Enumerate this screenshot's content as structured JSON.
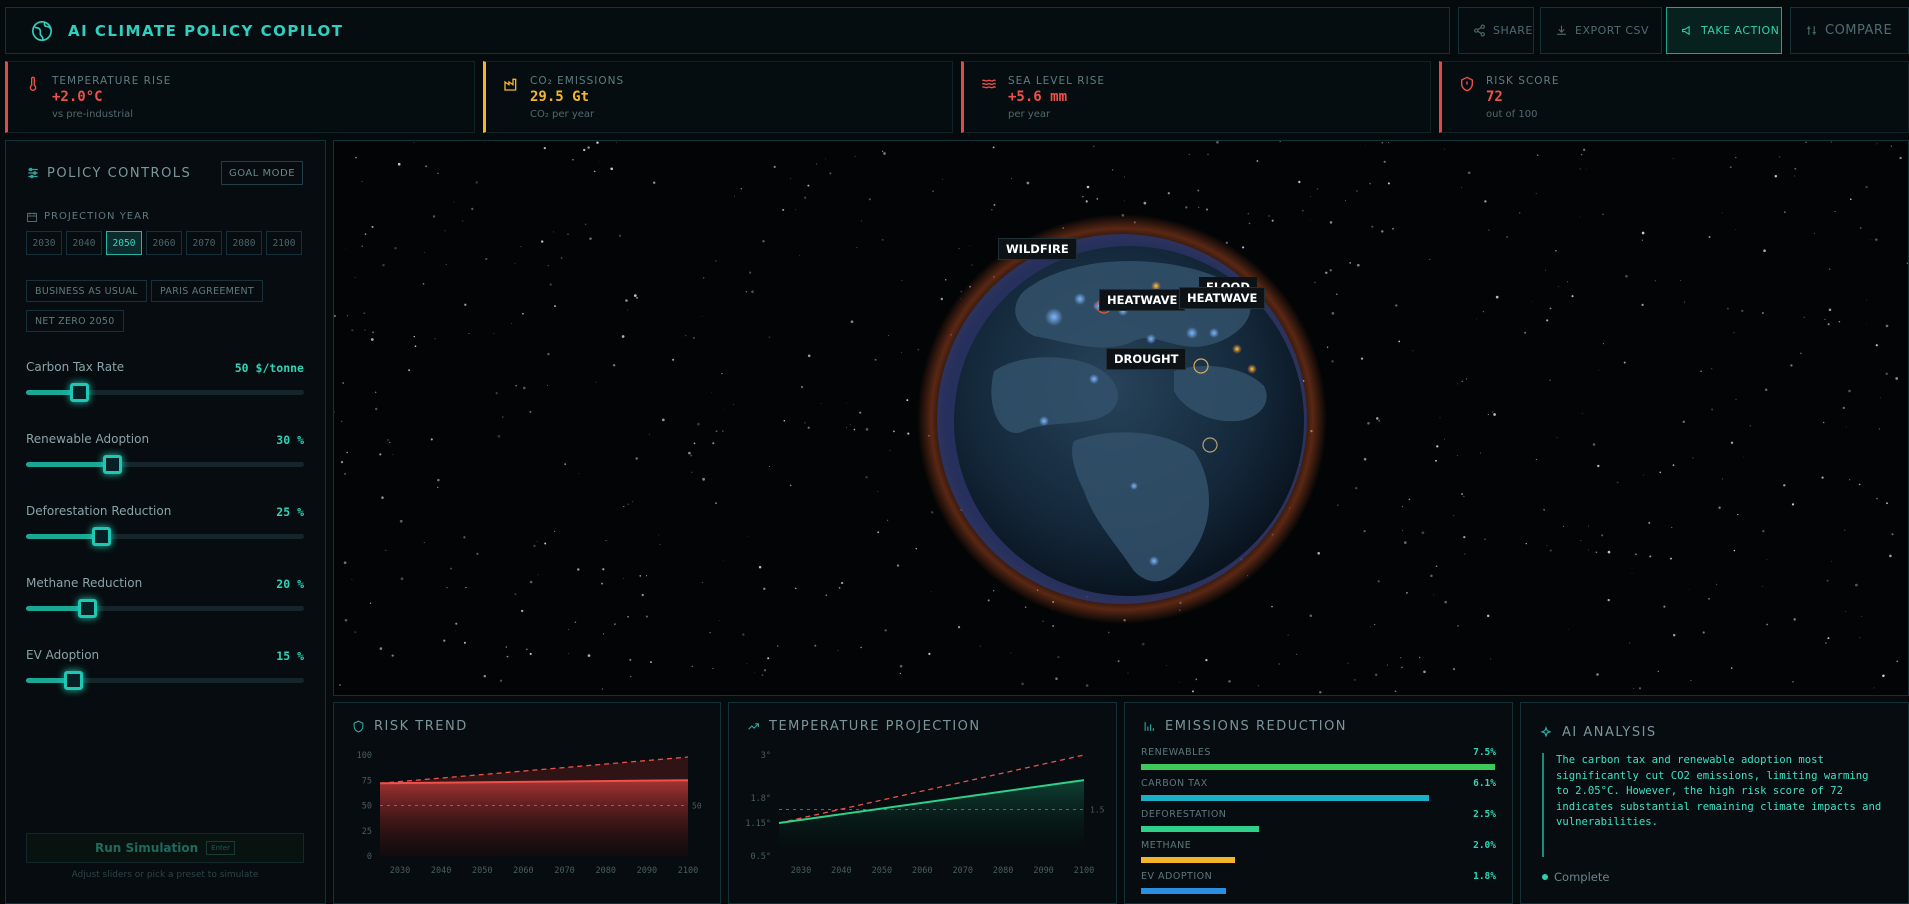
{
  "header": {
    "title": "AI CLIMATE POLICY COPILOT",
    "buttons": {
      "share": "SHARE",
      "export": "EXPORT CSV",
      "action": "TAKE ACTION",
      "compare": "COMPARE"
    }
  },
  "kpis": [
    {
      "label": "TEMPERATURE RISE",
      "value": "+2.0°C",
      "sub": "vs pre-industrial",
      "color": "#f0504a"
    },
    {
      "label": "CO₂ EMISSIONS",
      "value": "29.5 Gt",
      "sub": "CO₂ per year",
      "color": "#f5b52a"
    },
    {
      "label": "SEA LEVEL RISE",
      "value": "+5.6 mm",
      "sub": "per year",
      "color": "#f0504a"
    },
    {
      "label": "RISK SCORE",
      "value": "72",
      "sub": "out of 100",
      "color": "#f0504a"
    }
  ],
  "policy": {
    "title": "POLICY CONTROLS",
    "goal_mode": "GOAL MODE",
    "year_label": "PROJECTION YEAR",
    "years": [
      "2030",
      "2040",
      "2050",
      "2060",
      "2070",
      "2080",
      "2100"
    ],
    "selected_year": "2050",
    "presets": [
      "BUSINESS AS USUAL",
      "PARIS AGREEMENT",
      "NET ZERO 2050"
    ],
    "sliders": [
      {
        "label": "Carbon Tax Rate",
        "value": "50 $/tonne",
        "fraction": 0.19
      },
      {
        "label": "Renewable Adoption",
        "value": "30 %",
        "fraction": 0.31
      },
      {
        "label": "Deforestation Reduction",
        "value": "25 %",
        "fraction": 0.27
      },
      {
        "label": "Methane Reduction",
        "value": "20 %",
        "fraction": 0.22
      },
      {
        "label": "EV Adoption",
        "value": "15 %",
        "fraction": 0.17
      }
    ],
    "run_button": "Run Simulation",
    "run_badge": "Enter",
    "hint": "Adjust sliders or pick a preset to simulate"
  },
  "globe": {
    "events": [
      "WILDFIRE",
      "FLOOD",
      "HEATWAVE",
      "HEATWAVE",
      "DROUGHT"
    ]
  },
  "risk_trend": {
    "title": "RISK TREND",
    "chart_data": {
      "type": "area",
      "x": [
        2030,
        2100
      ],
      "series": [
        {
          "name": "",
          "values": [
            72,
            75
          ]
        },
        {
          "name": "",
          "values": [
            72,
            98
          ]
        }
      ],
      "threshold": 50,
      "threshold_label": "50",
      "ylim": [
        0,
        100
      ],
      "yticks": [
        "100",
        "75",
        "50",
        "25",
        "0"
      ],
      "xticks": [
        "2030",
        "2040",
        "2050",
        "2060",
        "2070",
        "2080",
        "2090",
        "2100"
      ]
    }
  },
  "temp_projection": {
    "title": "TEMPERATURE PROJECTION",
    "chart_data": {
      "type": "line",
      "x": [
        2030,
        2100
      ],
      "series": [
        {
          "name": "",
          "values": [
            1.15,
            2.3
          ]
        },
        {
          "name": "",
          "values": [
            1.15,
            3.0
          ]
        }
      ],
      "threshold": 1.5,
      "threshold_label": "1.5",
      "yticks": [
        "3°",
        "1.8°",
        "1.15°",
        "0.5°"
      ],
      "xticks": [
        "2030",
        "2040",
        "2050",
        "2060",
        "2070",
        "2080",
        "2090",
        "2100"
      ]
    }
  },
  "emissions": {
    "title": "EMISSIONS REDUCTION",
    "chart_data": {
      "type": "bar",
      "categories": [
        "RENEWABLES",
        "CARBON TAX",
        "DEFORESTATION",
        "METHANE",
        "EV ADOPTION"
      ],
      "values": [
        7.5,
        6.1,
        2.5,
        2.0,
        1.8
      ],
      "labels": [
        "7.5%",
        "6.1%",
        "2.5%",
        "2.0%",
        "1.8%"
      ],
      "colors": [
        "#3ec85a",
        "#1ab0c8",
        "#2fd08a",
        "#f5b52a",
        "#2a8fe0"
      ]
    }
  },
  "ai": {
    "title": "AI ANALYSIS",
    "text": "The carbon tax and renewable adoption most significantly cut CO2 emissions, limiting warming to 2.05°C. However, the high risk score of 72 indicates substantial remaining climate impacts and vulnerabilities.",
    "status": "Complete"
  }
}
